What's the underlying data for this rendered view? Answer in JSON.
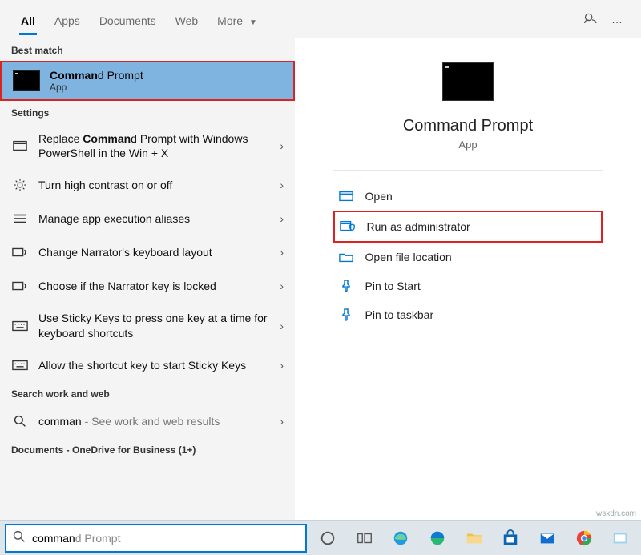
{
  "tabs": {
    "all": "All",
    "apps": "Apps",
    "documents": "Documents",
    "web": "Web",
    "more": "More"
  },
  "titlebar": {
    "feedback": "Feedback",
    "more": "…"
  },
  "sections": {
    "best_match": "Best match",
    "settings": "Settings",
    "search_web": "Search work and web",
    "docs": "Documents - OneDrive for Business (1+)"
  },
  "best_match": {
    "title_pre": "Comman",
    "title_rest": "d Prompt",
    "subtitle": "App"
  },
  "settings_items": [
    {
      "pre": "Replace ",
      "hl": "Comman",
      "post": "d Prompt with Windows PowerShell in the Win + X"
    },
    {
      "pre": "",
      "hl": "",
      "post": "Turn high contrast on or off"
    },
    {
      "pre": "",
      "hl": "",
      "post": "Manage app execution aliases"
    },
    {
      "pre": "",
      "hl": "",
      "post": "Change Narrator's keyboard layout"
    },
    {
      "pre": "",
      "hl": "",
      "post": "Choose if the Narrator key is locked"
    },
    {
      "pre": "",
      "hl": "",
      "post": "Use Sticky Keys to press one key at a time for keyboard shortcuts"
    },
    {
      "pre": "",
      "hl": "",
      "post": "Allow the shortcut key to start Sticky Keys"
    }
  ],
  "web_item": {
    "term": "comman",
    "note": " - See work and web results"
  },
  "preview": {
    "title": "Command Prompt",
    "subtitle": "App"
  },
  "actions": {
    "open": "Open",
    "run_admin": "Run as administrator",
    "open_loc": "Open file location",
    "pin_start": "Pin to Start",
    "pin_taskbar": "Pin to taskbar"
  },
  "search": {
    "typed": "comman",
    "ghost": "d Prompt",
    "value": "command Prompt"
  },
  "watermark": "wsxdn.com"
}
